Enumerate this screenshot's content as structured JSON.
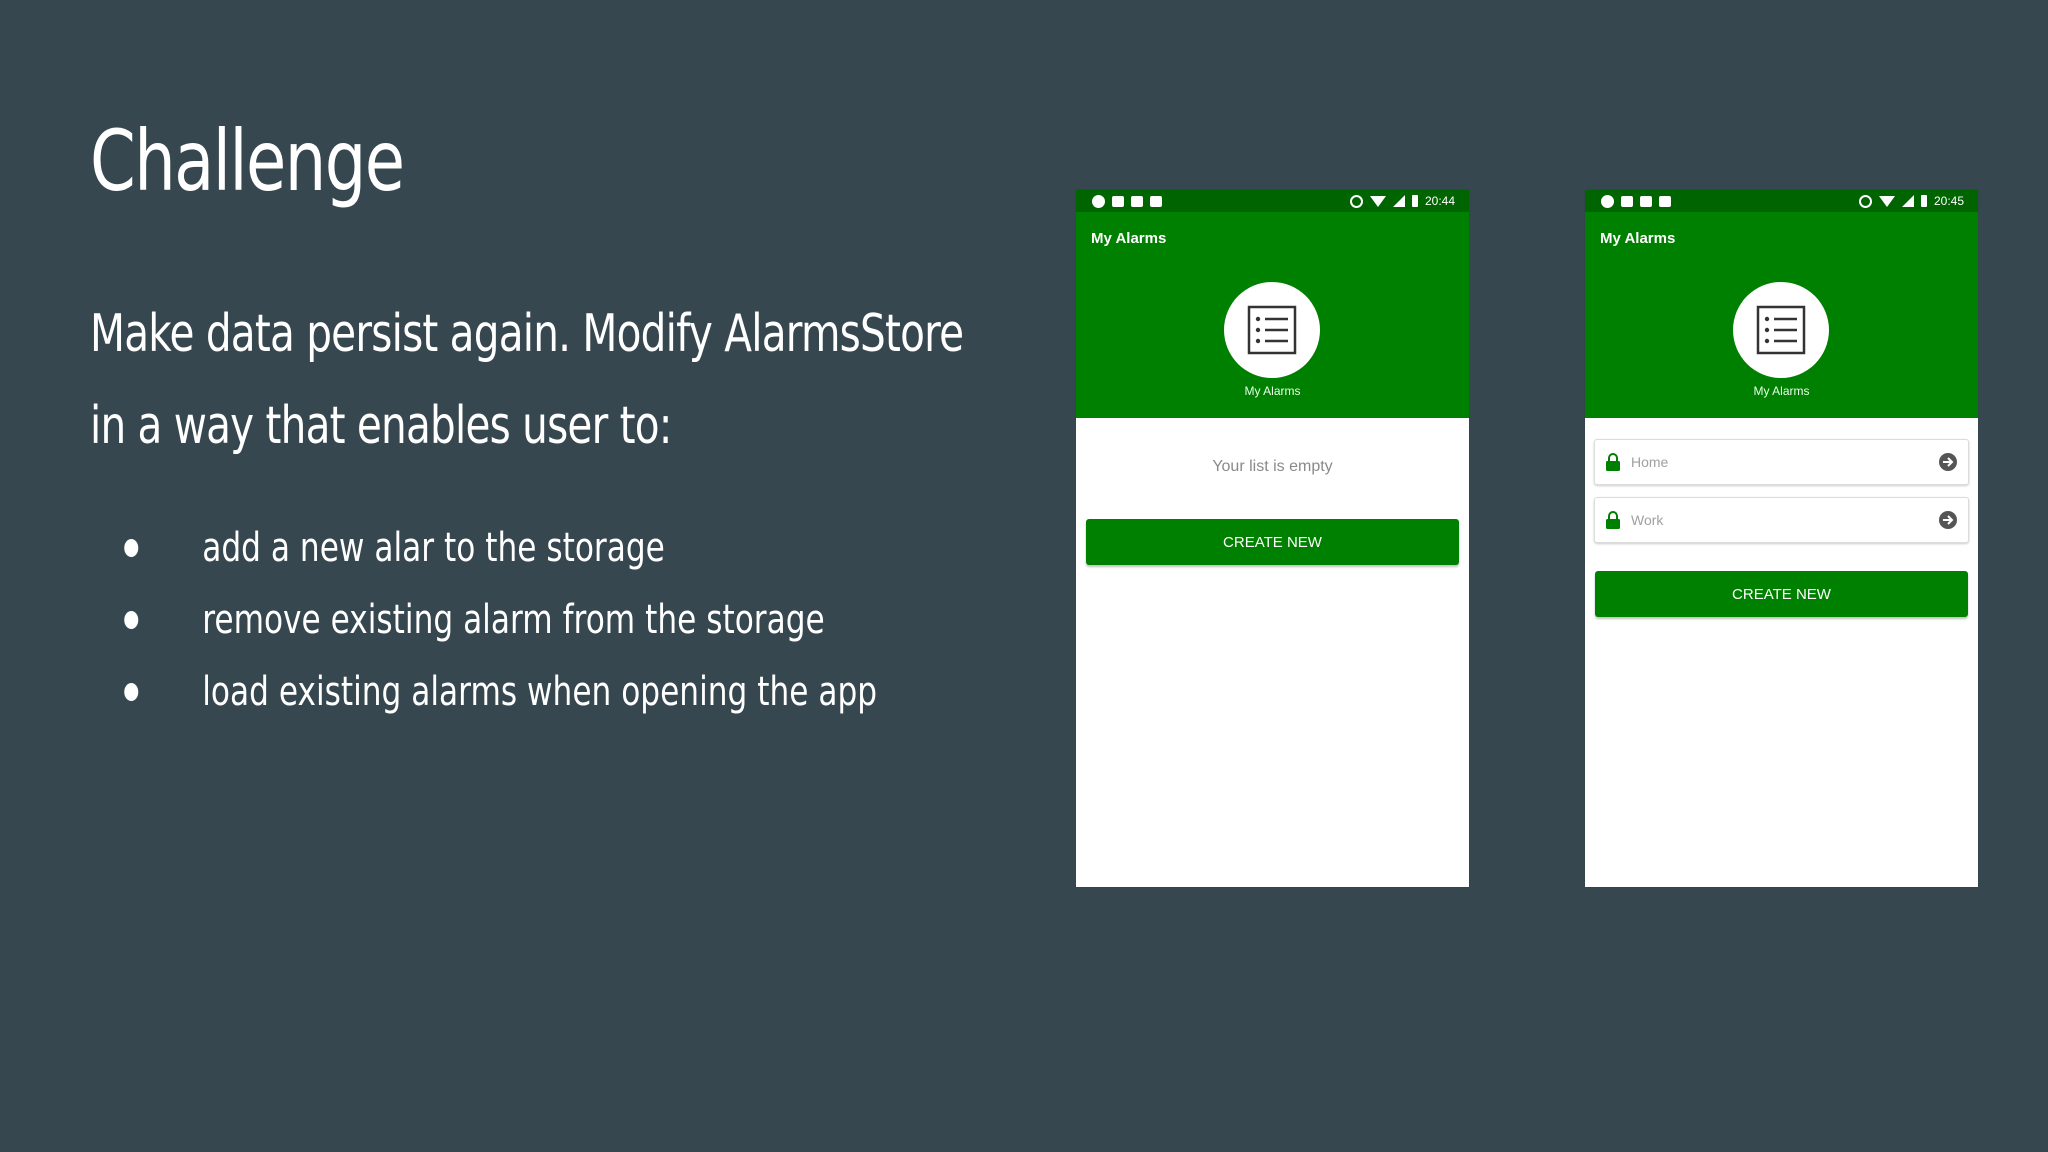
{
  "slide": {
    "title": "Challenge",
    "intro_line1": "Make data persist again. Modify AlarmsStore",
    "intro_line2": "in a way that enables user to:",
    "bullets": [
      "add a new alar to the storage",
      "remove existing alarm from the storage",
      "load existing alarms when opening the app"
    ]
  },
  "phones": [
    {
      "status_time": "20:44",
      "app_bar_title": "My Alarms",
      "header_caption": "My Alarms",
      "empty_text": "Your list is empty",
      "create_button": "CREATE NEW"
    },
    {
      "status_time": "20:45",
      "app_bar_title": "My Alarms",
      "header_caption": "My Alarms",
      "alarms": [
        {
          "placeholder": "Home"
        },
        {
          "placeholder": "Work"
        }
      ],
      "create_button": "CREATE NEW"
    }
  ],
  "colors": {
    "background": "#37474f",
    "status_bar": "#006400",
    "app_green": "#008000",
    "text_white": "#ffffff"
  },
  "icons": {
    "header": "list-icon",
    "alarm_row_leading": "lock-icon",
    "alarm_row_trailing": "arrow-circle-right-icon"
  }
}
